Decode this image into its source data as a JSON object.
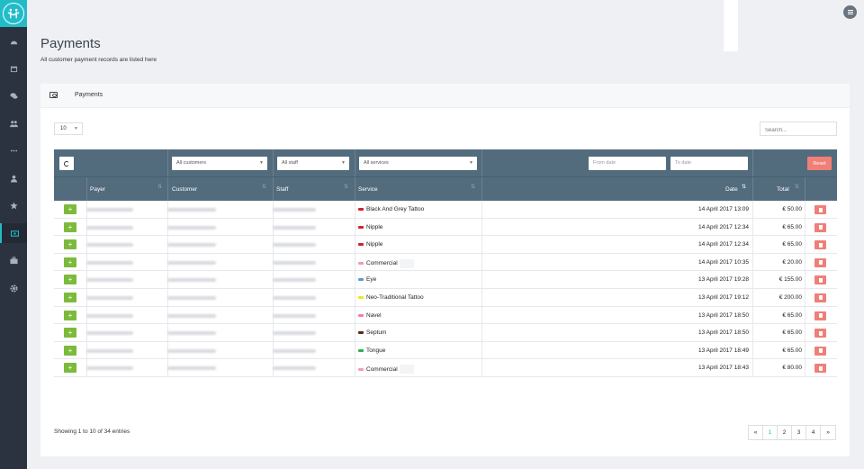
{
  "page": {
    "title": "Payments",
    "subtitle": "All customer payment records are listed here"
  },
  "card": {
    "tab_label": "Payments"
  },
  "controls": {
    "page_length": "10",
    "search_placeholder": "Search..."
  },
  "filters": {
    "customers": "All customers",
    "staff": "All staff",
    "services": "All services",
    "from_date": "From date",
    "to_date": "To date",
    "reset_label": "Reset"
  },
  "columns": {
    "payer": "Payer",
    "customer": "Customer",
    "staff": "Staff",
    "service": "Service",
    "date": "Date",
    "total": "Total"
  },
  "rows": [
    {
      "service": "Black And Grey Tattoo",
      "color": "#d0202a",
      "date": "14 April 2017 13:09",
      "total": "€ 50.00"
    },
    {
      "service": "Nipple",
      "color": "#d0202a",
      "date": "14 April 2017 12:34",
      "total": "€ 65.00"
    },
    {
      "service": "Nipple",
      "color": "#d0202a",
      "date": "14 April 2017 12:34",
      "total": "€ 65.00"
    },
    {
      "service": "Commercial",
      "color": "#f598b8",
      "date": "14 April 2017 10:35",
      "total": "€ 20.00"
    },
    {
      "service": "Eye",
      "color": "#5a9bd4",
      "date": "13 April 2017 19:28",
      "total": "€ 155.00"
    },
    {
      "service": "Neo-Traditional Tattoo",
      "color": "#f2e51c",
      "date": "13 April 2017 19:12",
      "total": "€ 200.00"
    },
    {
      "service": "Navel",
      "color": "#f07bb3",
      "date": "13 April 2017 18:50",
      "total": "€ 65.00"
    },
    {
      "service": "Septum",
      "color": "#5a2a14",
      "date": "13 April 2017 18:50",
      "total": "€ 65.00"
    },
    {
      "service": "Tongue",
      "color": "#2db34a",
      "date": "13 April 2017 18:49",
      "total": "€ 65.00"
    },
    {
      "service": "Commercial",
      "color": "#f598b8",
      "date": "13 April 2017 18:43",
      "total": "€ 80.00"
    }
  ],
  "footer": {
    "info": "Showing 1 to 10 of 34 entries"
  },
  "pagination": {
    "prev": "«",
    "next": "»",
    "pages": [
      "1",
      "2",
      "3",
      "4"
    ],
    "active_page": "1"
  },
  "colors": {
    "accent": "#22bcc9",
    "table_header": "#526b7d",
    "add": "#7cba3c",
    "delete": "#f07f77",
    "sidebar": "#2c3340"
  },
  "sidebar": {
    "icons": [
      "dashboard-icon",
      "calendar-icon",
      "chat-icon",
      "users-icon",
      "more-icon",
      "user-icon",
      "star-icon",
      "payments-icon",
      "briefcase-icon",
      "gear-icon"
    ],
    "active_index": 7
  }
}
